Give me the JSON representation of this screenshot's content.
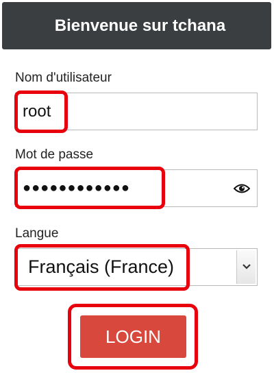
{
  "header": {
    "title": "Bienvenue sur tchana"
  },
  "username": {
    "label": "Nom d'utilisateur",
    "value": "root"
  },
  "password": {
    "label": "Mot de passe",
    "masked_value": "●●●●●●●●●●●●",
    "show_icon": "eye-icon"
  },
  "language": {
    "label": "Langue",
    "selected": "Français (France)",
    "dropdown_icon": "chevron-down-icon"
  },
  "login": {
    "label": "LOGIN"
  },
  "colors": {
    "header_bg": "#3a3e40",
    "button_bg": "#d9483d",
    "highlight": "#e8000c"
  }
}
